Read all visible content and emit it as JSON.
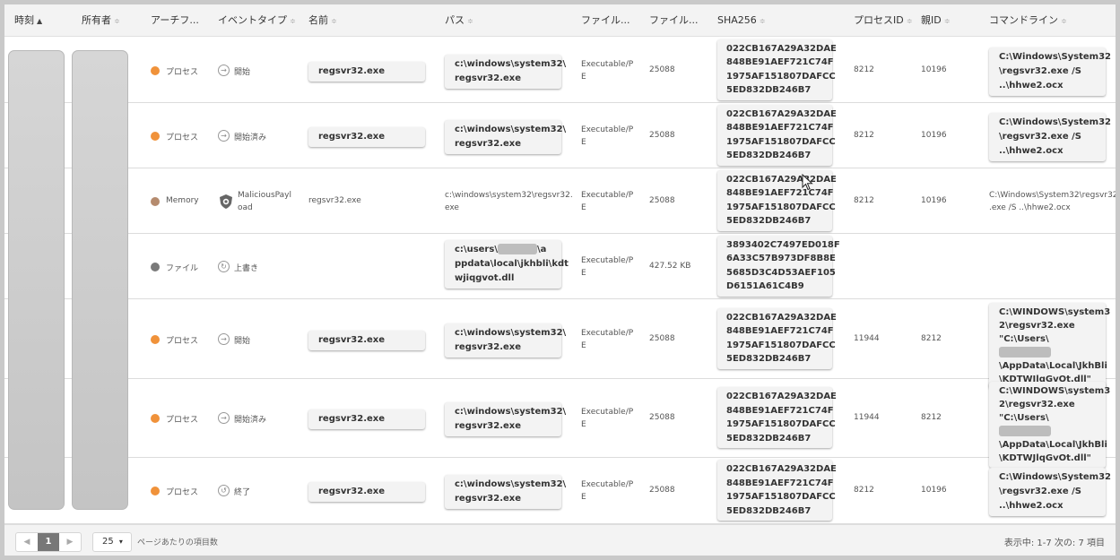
{
  "headers": [
    {
      "label": "時刻",
      "sort": "▲"
    },
    {
      "label": "所有者",
      "sort": "≑"
    },
    {
      "label": "アーチフ...",
      "sort": ""
    },
    {
      "label": "イベントタイプ",
      "sort": "≑"
    },
    {
      "label": "名前",
      "sort": "≑"
    },
    {
      "label": "パス",
      "sort": "≑"
    },
    {
      "label": "ファイル...",
      "sort": ""
    },
    {
      "label": "ファイル...",
      "sort": ""
    },
    {
      "label": "SHA256",
      "sort": "≑"
    },
    {
      "label": "プロセスID",
      "sort": "≑"
    },
    {
      "label": "親ID",
      "sort": "≑"
    },
    {
      "label": "コマンドライン",
      "sort": "≑"
    }
  ],
  "rows": [
    {
      "artifact": "プロセス",
      "artifact_color": "#f0923a",
      "event": "開始",
      "event_icon": "arrow-circle-icon",
      "name": "regsvr32.exe",
      "path": "c:\\windows\\system32\\\nregsvr32.exe",
      "filetype": "Executable/P\nE",
      "filesize": "25088",
      "sha": "022CB167A29A32DAE\n848BE91AEF721C74F\n1975AF151807DAFCC\n5ED832DB246B7",
      "pid": "8212",
      "ppid": "10196",
      "cmd": "C:\\Windows\\System32\n\\regsvr32.exe /S\n..\\hhwe2.ocx"
    },
    {
      "artifact": "プロセス",
      "artifact_color": "#f0923a",
      "event": "開始済み",
      "event_icon": "arrow-circle-icon",
      "name": "regsvr32.exe",
      "path": "c:\\windows\\system32\\\nregsvr32.exe",
      "filetype": "Executable/P\nE",
      "filesize": "25088",
      "sha": "022CB167A29A32DAE\n848BE91AEF721C74F\n1975AF151807DAFCC\n5ED832DB246B7",
      "pid": "8212",
      "ppid": "10196",
      "cmd": "C:\\Windows\\System32\n\\regsvr32.exe /S\n..\\hhwe2.ocx"
    },
    {
      "artifact": "Memory",
      "artifact_color": "#b58b6e",
      "event": "MaliciousPayl\noad",
      "event_icon": "shield-icon",
      "name": "regsvr32.exe",
      "path": "c:\\windows\\system32\\regsvr32.\nexe",
      "filetype": "Executable/P\nE",
      "filesize": "25088",
      "sha": "022CB167A29A32DAE\n848BE91AEF721C74F\n1975AF151807DAFCC\n5ED832DB246B7",
      "pid": "8212",
      "ppid": "10196",
      "cmd": "C:\\Windows\\System32\\regsvr32\n.exe /S ..\\hhwe2.ocx"
    },
    {
      "artifact": "ファイル",
      "artifact_color": "#7a7a7a",
      "event": "上書き",
      "event_icon": "overwrite-icon",
      "name": "",
      "path_pre": "c:\\users\\",
      "path_post": "\\a\nppdata\\local\\jkhbli\\kdt\nwjiqgvot.dll",
      "filetype": "Executable/P\nE",
      "filesize": "427.52 KB",
      "sha": "3893402C7497ED018F\n6A33C57B973DF8B8E\n5685D3C4D53AEF105\nD6151A61C4B9",
      "pid": "",
      "ppid": "",
      "cmd": ""
    },
    {
      "artifact": "プロセス",
      "artifact_color": "#f0923a",
      "event": "開始",
      "event_icon": "arrow-circle-icon",
      "name": "regsvr32.exe",
      "path": "c:\\windows\\system32\\\nregsvr32.exe",
      "filetype": "Executable/P\nE",
      "filesize": "25088",
      "sha": "022CB167A29A32DAE\n848BE91AEF721C74F\n1975AF151807DAFCC\n5ED832DB246B7",
      "pid": "11944",
      "ppid": "8212",
      "cmd_pre": "C:\\WINDOWS\\system3\n2\\regsvr32.exe\n\"C:\\Users\\",
      "cmd_post": "\n\\AppData\\Local\\JkhBli\n\\KDTWJlqGvOt.dll\""
    },
    {
      "artifact": "プロセス",
      "artifact_color": "#f0923a",
      "event": "開始済み",
      "event_icon": "arrow-circle-icon",
      "name": "regsvr32.exe",
      "path": "c:\\windows\\system32\\\nregsvr32.exe",
      "filetype": "Executable/P\nE",
      "filesize": "25088",
      "sha": "022CB167A29A32DAE\n848BE91AEF721C74F\n1975AF151807DAFCC\n5ED832DB246B7",
      "pid": "11944",
      "ppid": "8212",
      "cmd_pre": "C:\\WINDOWS\\system3\n2\\regsvr32.exe\n\"C:\\Users\\",
      "cmd_post": "\n\\AppData\\Local\\JkhBli\n\\KDTWJlqGvOt.dll\""
    },
    {
      "artifact": "プロセス",
      "artifact_color": "#f0923a",
      "event": "終了",
      "event_icon": "undo-circle-icon",
      "name": "regsvr32.exe",
      "path": "c:\\windows\\system32\\\nregsvr32.exe",
      "filetype": "Executable/P\nE",
      "filesize": "25088",
      "sha": "022CB167A29A32DAE\n848BE91AEF721C74F\n1975AF151807DAFCC\n5ED832DB246B7",
      "pid": "8212",
      "ppid": "10196",
      "cmd": "C:\\Windows\\System32\n\\regsvr32.exe /S\n..\\hhwe2.ocx"
    }
  ],
  "footer": {
    "prev": "◀",
    "page": "1",
    "next": "▶",
    "per_page": "25",
    "per_page_caret": "▾",
    "per_page_label": "ページあたりの項目数",
    "summary": "表示中: 1-7 次の: 7 項目"
  }
}
